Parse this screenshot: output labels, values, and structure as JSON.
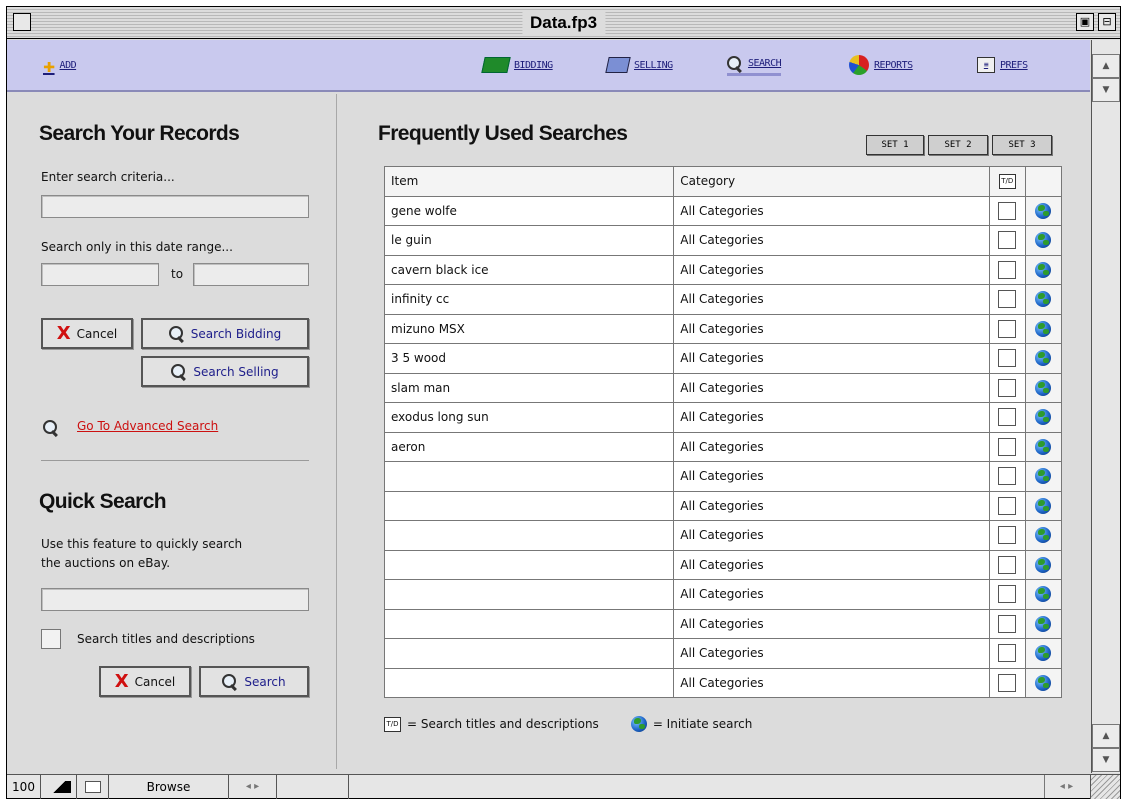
{
  "window": {
    "title": "Data.fp3"
  },
  "toolbar": {
    "add": "ADD",
    "bidding": "BIDDING",
    "selling": "SELLING",
    "search": "SEARCH",
    "reports": "REPORTS",
    "prefs": "PREFS"
  },
  "search_records": {
    "heading": "Search Your Records",
    "criteria_label": "Enter search criteria...",
    "criteria_value": "",
    "date_label": "Search only in this date range...",
    "date_to": "to",
    "date_from_value": "",
    "date_to_value": "",
    "cancel": "Cancel",
    "search_bidding": "Search Bidding",
    "search_selling": "Search Selling",
    "advanced_link": "Go To Advanced Search"
  },
  "quick_search": {
    "heading": "Quick Search",
    "desc_line1": "Use this feature to quickly search",
    "desc_line2": "the auctions on eBay.",
    "input_value": "",
    "checkbox_label": "Search titles and descriptions",
    "checkbox_checked": false,
    "cancel": "Cancel",
    "search": "Search"
  },
  "frequent": {
    "heading": "Frequently Used Searches",
    "sets": [
      "SET 1",
      "SET 2",
      "SET 3"
    ],
    "columns": {
      "item": "Item",
      "category": "Category",
      "tag": "T/D"
    },
    "rows": [
      {
        "item": "gene wolfe",
        "category": "All Categories"
      },
      {
        "item": "le guin",
        "category": "All Categories"
      },
      {
        "item": "cavern black ice",
        "category": "All Categories"
      },
      {
        "item": "infinity cc",
        "category": "All Categories"
      },
      {
        "item": "mizuno MSX",
        "category": "All Categories"
      },
      {
        "item": "3 5 wood",
        "category": "All Categories"
      },
      {
        "item": "slam man",
        "category": "All Categories"
      },
      {
        "item": "exodus long sun",
        "category": "All Categories"
      },
      {
        "item": "aeron",
        "category": "All Categories"
      },
      {
        "item": "",
        "category": "All Categories"
      },
      {
        "item": "",
        "category": "All Categories"
      },
      {
        "item": "",
        "category": "All Categories"
      },
      {
        "item": "",
        "category": "All Categories"
      },
      {
        "item": "",
        "category": "All Categories"
      },
      {
        "item": "",
        "category": "All Categories"
      },
      {
        "item": "",
        "category": "All Categories"
      },
      {
        "item": "",
        "category": "All Categories"
      }
    ],
    "legend_tag_text": "= Search titles and descriptions",
    "legend_globe_text": "= Initiate search"
  },
  "status_bar": {
    "zoom": "100",
    "mode": "Browse"
  }
}
